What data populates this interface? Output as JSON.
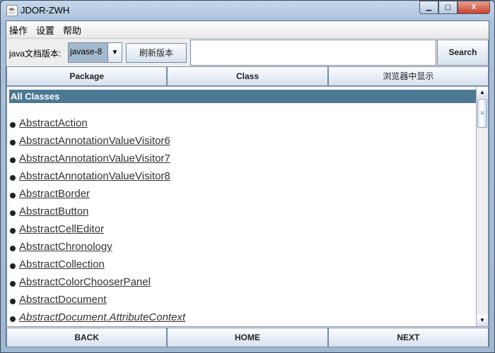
{
  "window": {
    "title": "JDOR-ZWH",
    "close": "X"
  },
  "menu": [
    "操作",
    "设置",
    "帮助"
  ],
  "toolbar": {
    "version_label": "java文档版本:",
    "version_value": "javase-8",
    "refresh": "刷新版本",
    "search_value": "",
    "search": "Search"
  },
  "tabs": [
    "Package",
    "Class",
    "浏览器中显示"
  ],
  "list": {
    "header": "All Classes",
    "items": [
      {
        "name": "AbstractAction",
        "italic": false
      },
      {
        "name": "AbstractAnnotationValueVisitor6",
        "italic": false
      },
      {
        "name": "AbstractAnnotationValueVisitor7",
        "italic": false
      },
      {
        "name": "AbstractAnnotationValueVisitor8",
        "italic": false
      },
      {
        "name": "AbstractBorder",
        "italic": false
      },
      {
        "name": "AbstractButton",
        "italic": false
      },
      {
        "name": "AbstractCellEditor",
        "italic": false
      },
      {
        "name": "AbstractChronology",
        "italic": false
      },
      {
        "name": "AbstractCollection",
        "italic": false
      },
      {
        "name": "AbstractColorChooserPanel",
        "italic": false
      },
      {
        "name": "AbstractDocument",
        "italic": false
      },
      {
        "name": "AbstractDocument.AttributeContext",
        "italic": true
      }
    ]
  },
  "nav": [
    "BACK",
    "HOME",
    "NEXT"
  ]
}
